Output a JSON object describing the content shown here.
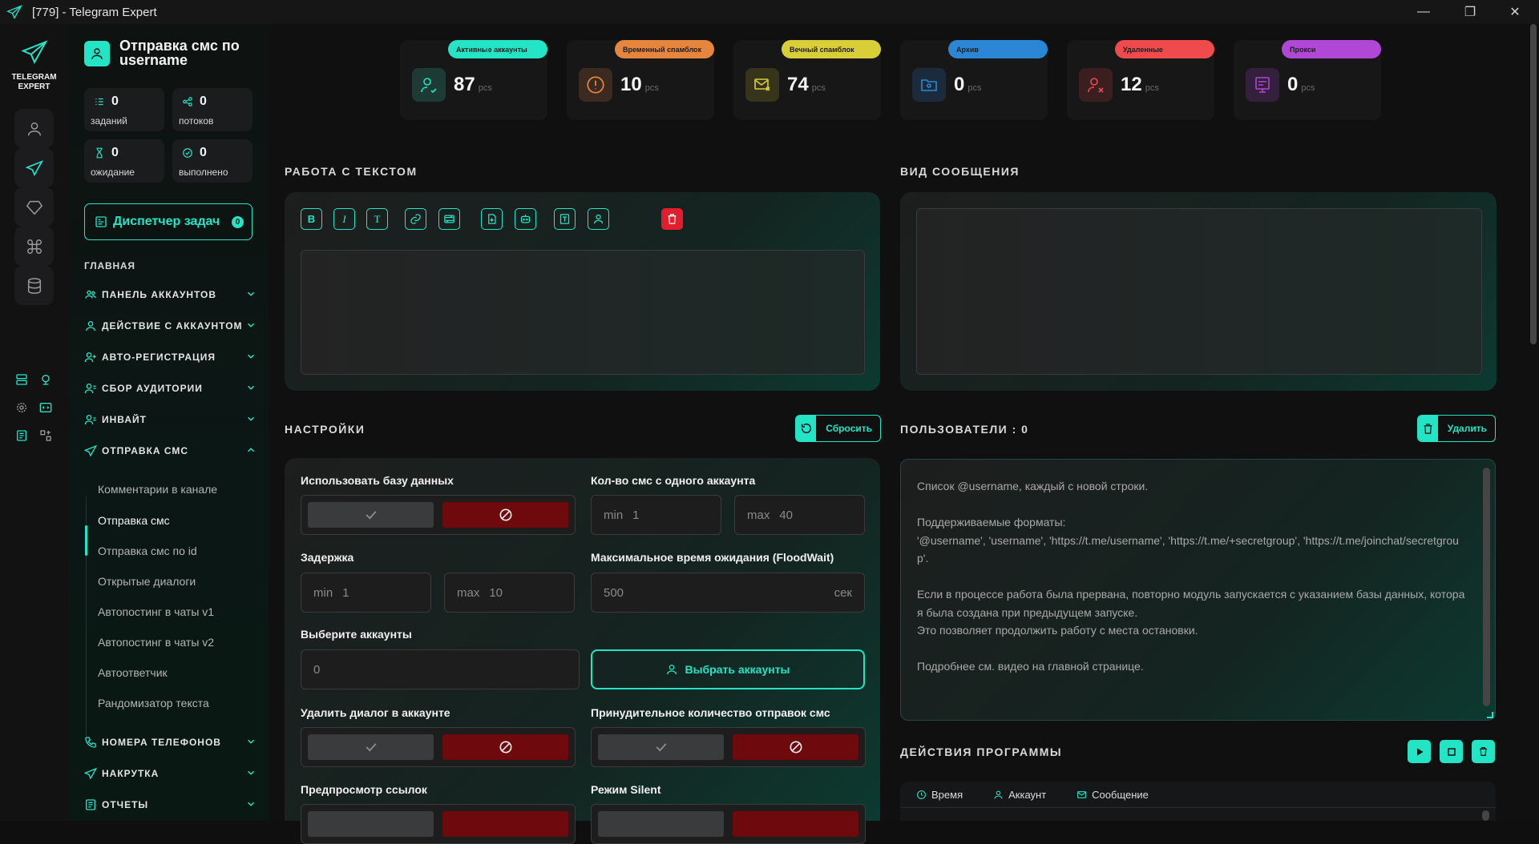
{
  "window": {
    "title": "[779] - Telegram Expert",
    "minimize": "—",
    "maximize": "❐",
    "close": "✕"
  },
  "brand": {
    "line1": "TELEGRAM",
    "line2": "EXPERT"
  },
  "sidebar": {
    "title": "Отправка смс по username",
    "stats": [
      {
        "value": "0",
        "label": "заданий"
      },
      {
        "value": "0",
        "label": "потоков"
      },
      {
        "value": "0",
        "label": "ожидание"
      },
      {
        "value": "0",
        "label": "выполнено"
      }
    ],
    "dispatcher": {
      "label": "Диспетчер задач",
      "count": "0"
    },
    "section": "ГЛАВНАЯ",
    "nav": [
      {
        "label": "ПАНЕЛЬ АККАУНТОВ"
      },
      {
        "label": "ДЕЙСТВИЕ С АККАУНТОМ"
      },
      {
        "label": "АВТО-РЕГИСТРАЦИЯ"
      },
      {
        "label": "СБОР АУДИТОРИИ"
      },
      {
        "label": "ИНВАЙТ"
      },
      {
        "label": "ОТПРАВКА СМС"
      }
    ],
    "sub": [
      {
        "label": "Комментарии в канале"
      },
      {
        "label": "Отправка смс"
      },
      {
        "label": "Отправка смс по id"
      },
      {
        "label": "Открытые диалоги"
      },
      {
        "label": "Автопостинг в чаты v1"
      },
      {
        "label": "Автопостинг в чаты v2"
      },
      {
        "label": "Автоответчик"
      },
      {
        "label": "Рандомизатор текста"
      }
    ],
    "nav_bottom": [
      {
        "label": "НОМЕРА ТЕЛЕФОНОВ"
      },
      {
        "label": "НАКРУТКА"
      },
      {
        "label": "ОТЧЕТЫ"
      }
    ]
  },
  "cards": [
    {
      "label": "Активные аккаунты",
      "value": "87",
      "unit": "pcs",
      "color": "#23e4c5",
      "icon": "user-check-icon"
    },
    {
      "label": "Временный спамблок",
      "value": "10",
      "unit": "pcs",
      "color": "#e6853e",
      "icon": "alert-icon"
    },
    {
      "label": "Вечный спамблок",
      "value": "74",
      "unit": "pcs",
      "color": "#d8cf38",
      "icon": "mail-block-icon"
    },
    {
      "label": "Архив",
      "value": "0",
      "unit": "pcs",
      "color": "#2b86d6",
      "icon": "folder-user-icon"
    },
    {
      "label": "Удаленные",
      "value": "12",
      "unit": "pcs",
      "color": "#ef4b4d",
      "icon": "user-remove-icon"
    },
    {
      "label": "Прокси",
      "value": "0",
      "unit": "pcs",
      "color": "#b047d6",
      "icon": "proxy-icon"
    }
  ],
  "text_section": {
    "title": "РАБОТА С ТЕКСТОМ",
    "tools": [
      "B",
      "I",
      "T"
    ]
  },
  "preview_section": {
    "title": "ВИД СООБЩЕНИЯ"
  },
  "settings": {
    "title": "НАСТРОЙКИ",
    "reset": "Сбросить",
    "use_db": "Использовать базу данных",
    "sms_count": "Кол-во смс с одного аккаунта",
    "sms_min_label": "min",
    "sms_min": "1",
    "sms_max_label": "max",
    "sms_max": "40",
    "delay": "Задержка",
    "delay_min_label": "min",
    "delay_min": "1",
    "delay_max_label": "max",
    "delay_max": "10",
    "floodwait": "Максимальное время ожидания (FloodWait)",
    "floodwait_value": "500",
    "floodwait_unit": "сек",
    "choose_accounts": "Выберите аккаунты",
    "accounts_value": "0",
    "choose_btn": "Выбрать аккаунты",
    "delete_dialog": "Удалить диалог в аккаунте",
    "force_count": "Принудительное количество отправок смс",
    "link_preview": "Предпросмотр ссылок",
    "silent": "Режим Silent"
  },
  "users": {
    "title": "ПОЛЬЗОВАТЕЛИ : 0",
    "delete": "Удалить",
    "placeholder": "Список @username, каждый с новой строки.\n\nПоддерживаемые форматы:\n'@username', 'username', 'https://t.me/username', 'https://t.me/+secretgroup', 'https://t.me/joinchat/secretgroup'.\n\nЕсли в процессе работа была прервана, повторно модуль запускается с указанием базы данных, которая была создана при предыдущем запуске.\nЭто позволяет продолжить работу с места остановки.\n\nПодробнее см. видео на главной странице."
  },
  "actions": {
    "title": "ДЕЙСТВИЯ ПРОГРАММЫ",
    "cols": [
      "Время",
      "Аккаунт",
      "Сообщение"
    ]
  }
}
